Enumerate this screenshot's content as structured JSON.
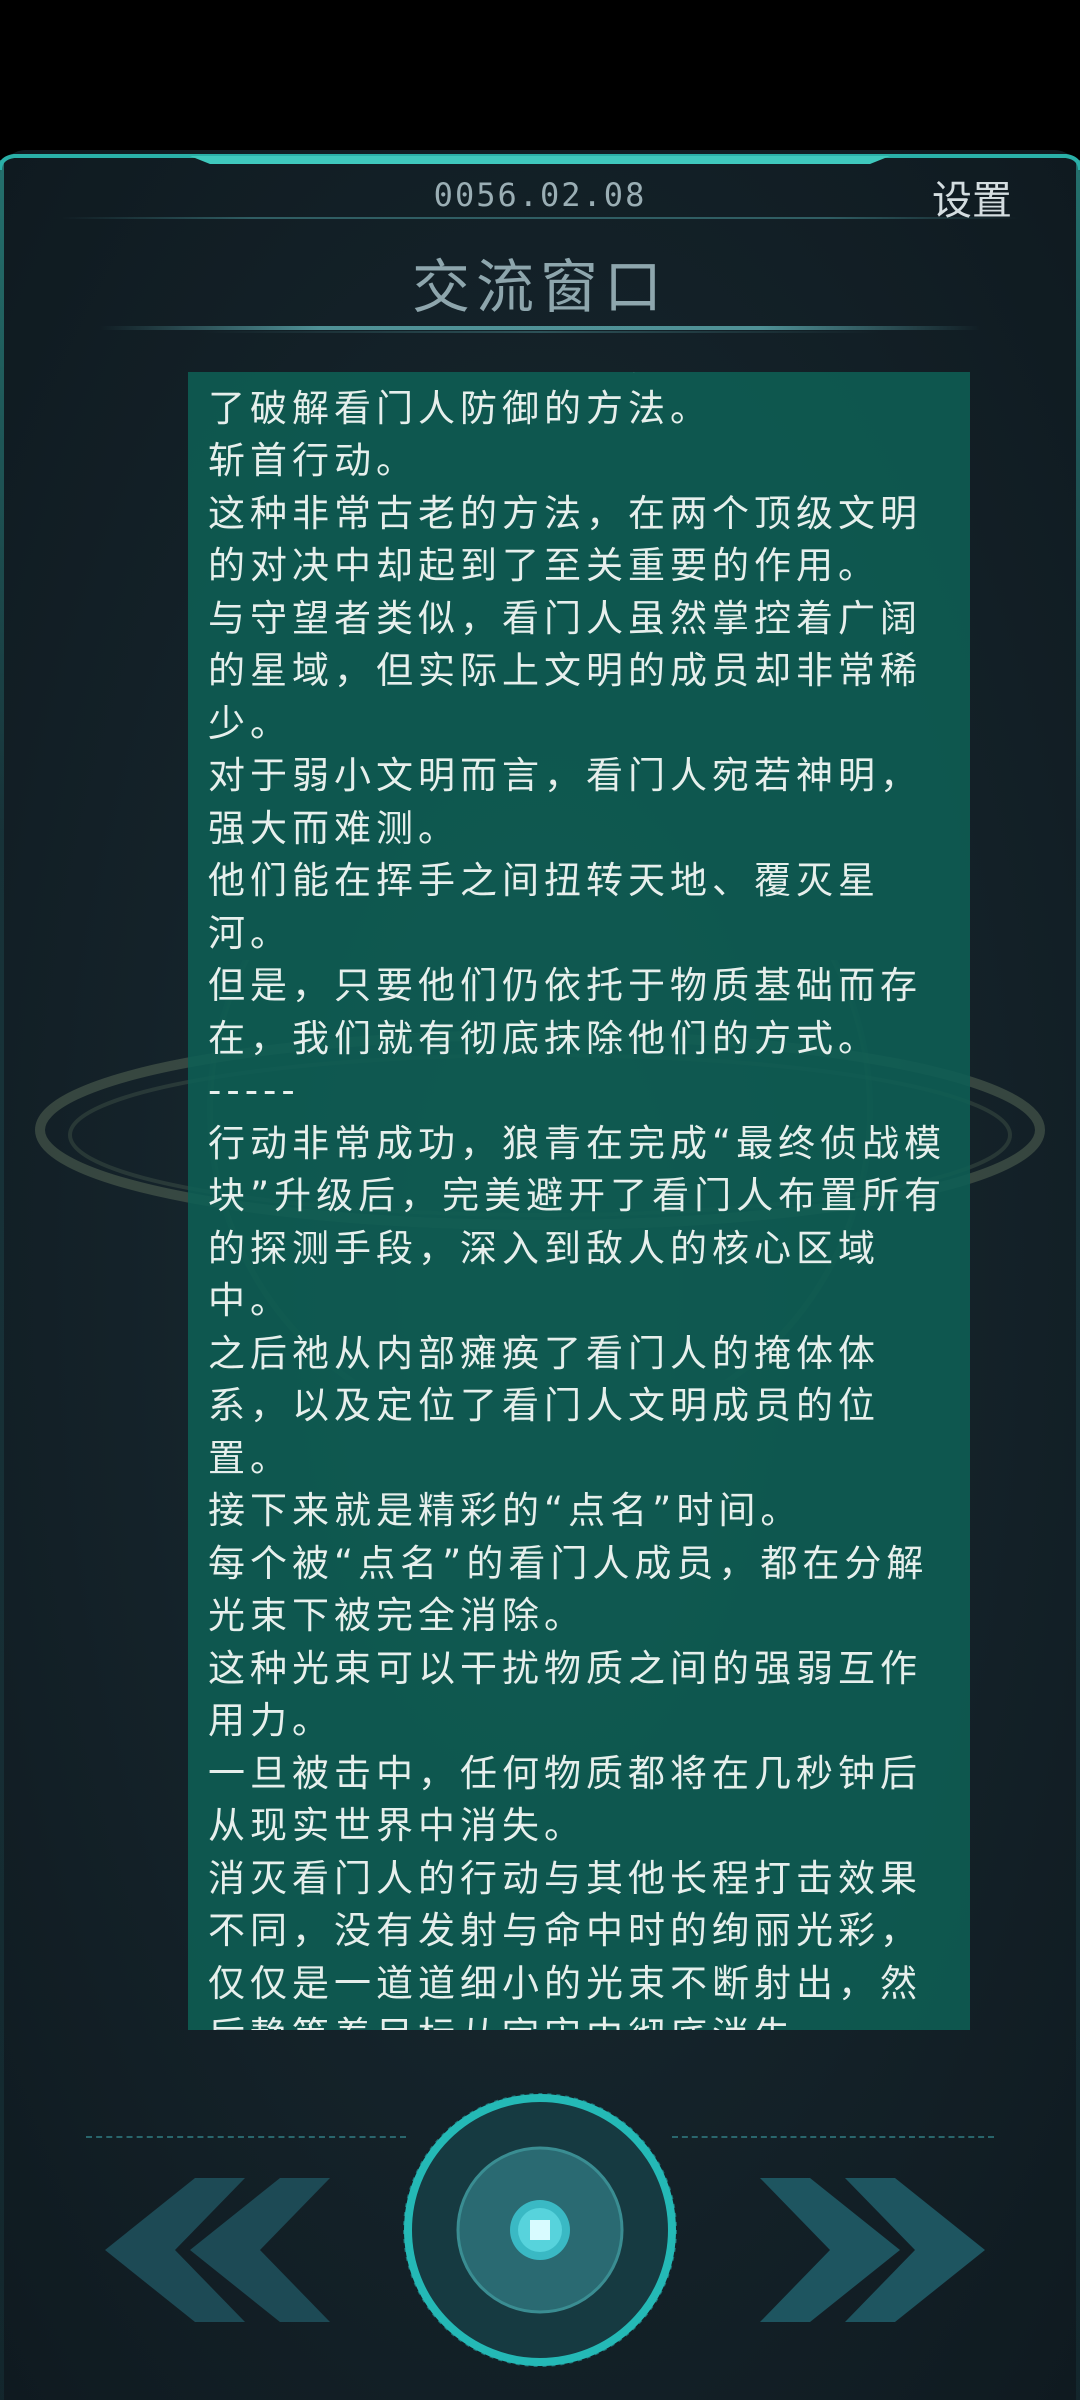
{
  "header": {
    "date": "0056.02.08",
    "settings_label": "设置",
    "title": "交流窗口"
  },
  "content": {
    "text": "经过两次失败的打击后，材该终于找到了破解看门人防御的方法。\n斩首行动。\n这种非常古老的方法，在两个顶级文明的对决中却起到了至关重要的作用。\n与守望者类似，看门人虽然掌控着广阔的星域，但实际上文明的成员却非常稀少。\n对于弱小文明而言，看门人宛若神明，强大而难测。\n他们能在挥手之间扭转天地、覆灭星河。\n但是，只要他们仍依托于物质基础而存在，我们就有彻底抹除他们的方式。\n-----\n行动非常成功，狼青在完成“最终侦战模块”升级后，完美避开了看门人布置所有的探测手段，深入到敌人的核心区域中。\n之后祂从内部瘫痪了看门人的掩体体系，以及定位了看门人文明成员的位置。\n接下来就是精彩的“点名”时间。\n每个被“点名”的看门人成员，都在分解光束下被完全消除。\n这种光束可以干扰物质之间的强弱互作用力。\n一旦被击中，任何物质都将在几秒钟后从现实世界中消失。\n消灭看门人的行动与其他长程打击效果不同，没有发射与命中时的绚丽光彩，仅仅是一道道细小的光束不断射出，然后静等着目标从宇宙中彻底消失。\n就这样，在可怕的静谧中过去了数十个"
  },
  "controls": {
    "prev_icon": "double-chevron-left-icon",
    "center_icon": "home-core-button-icon",
    "next_icon": "double-chevron-right-icon"
  },
  "colors": {
    "panel": "#0e5f54",
    "accent": "#2ec4c0",
    "background": "#142229",
    "text": "#e6efec"
  }
}
